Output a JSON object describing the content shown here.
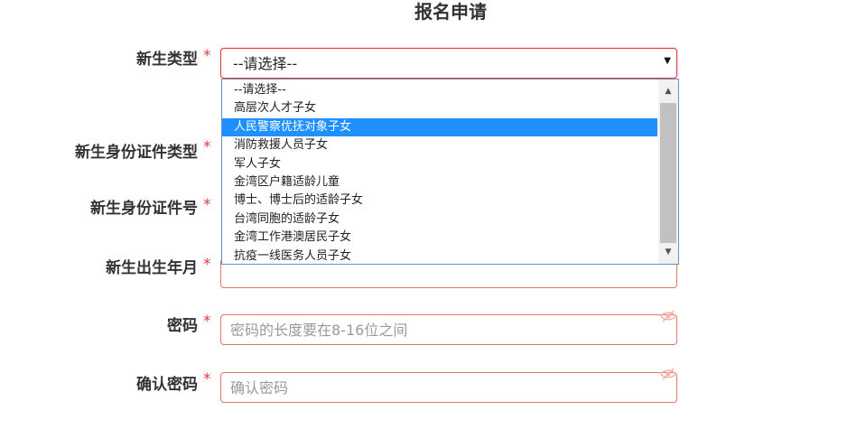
{
  "page": {
    "title": "报名申请"
  },
  "form": {
    "required_mark": "*",
    "fields": {
      "student_type": {
        "label": "新生类型",
        "value": "--请选择--"
      },
      "id_type": {
        "label": "新生身份证件类型"
      },
      "id_number": {
        "label": "新生身份证件号"
      },
      "birth_date": {
        "label": "新生出生年月"
      },
      "password": {
        "label": "密码",
        "placeholder": "密码的长度要在8-16位之间"
      },
      "confirm_password": {
        "label": "确认密码",
        "placeholder": "确认密码"
      }
    }
  },
  "dropdown": {
    "selected_index": 2,
    "options": [
      "--请选择--",
      "高层次人才子女",
      "人民警察优抚对象子女",
      "消防救援人员子女",
      "军人子女",
      "金湾区户籍适龄儿童",
      "博士、博士后的适龄子女",
      "台湾同胞的适龄子女",
      "金湾工作港澳居民子女",
      "抗疫一线医务人员子女"
    ]
  },
  "colors": {
    "error_border": "#e27766",
    "required_star": "#e4393c",
    "highlight": "#1e90ff"
  }
}
